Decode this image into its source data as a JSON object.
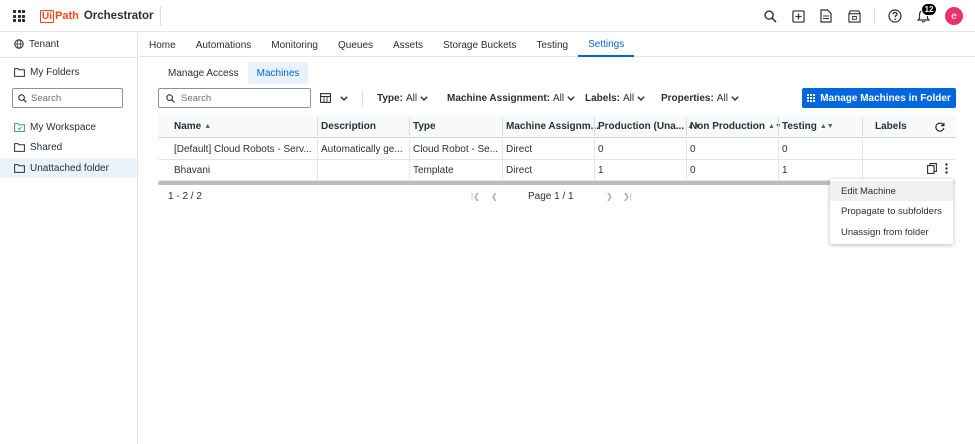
{
  "brand": {
    "logo_ui": "Ui",
    "logo_path": "Path",
    "product": "Orchestrator"
  },
  "topbar": {
    "notification_count": "12",
    "avatar_initial": "e"
  },
  "sidebar": {
    "tenant": "Tenant",
    "my_folders": "My Folders",
    "search_placeholder": "Search",
    "items": [
      {
        "label": "My Workspace",
        "icon": "workspace-icon"
      },
      {
        "label": "Shared",
        "icon": "folder-icon"
      },
      {
        "label": "Unattached folder",
        "icon": "folder-icon",
        "selected": true
      }
    ]
  },
  "main_tabs": [
    "Home",
    "Automations",
    "Monitoring",
    "Queues",
    "Assets",
    "Storage Buckets",
    "Testing",
    "Settings"
  ],
  "main_tabs_active": "Settings",
  "sub_tabs": [
    "Manage Access",
    "Machines"
  ],
  "sub_tabs_active": "Machines",
  "toolbar": {
    "search_placeholder": "Search",
    "filters": [
      {
        "label": "Type:",
        "value": "All"
      },
      {
        "label": "Machine Assignment:",
        "value": "All"
      },
      {
        "label": "Labels:",
        "value": "All"
      },
      {
        "label": "Properties:",
        "value": "All"
      }
    ],
    "primary_button": "Manage Machines in Folder"
  },
  "table": {
    "columns": [
      "Name",
      "Description",
      "Type",
      "Machine Assignm...",
      "Production (Una...",
      "Non Production",
      "Testing",
      "Labels"
    ],
    "rows": [
      {
        "name": "[Default] Cloud Robots - Serv...",
        "description": "Automatically ge...",
        "type": "Cloud Robot - Se...",
        "assignment": "Direct",
        "production": "0",
        "non_production": "0",
        "testing": "0",
        "labels": ""
      },
      {
        "name": "Bhavani",
        "description": "",
        "type": "Template",
        "assignment": "Direct",
        "production": "1",
        "non_production": "0",
        "testing": "1",
        "labels": ""
      }
    ]
  },
  "pager": {
    "count": "1 - 2 / 2",
    "page": "Page 1 / 1"
  },
  "context_menu": {
    "items": [
      "Edit Machine",
      "Propagate to subfolders",
      "Unassign from folder"
    ],
    "hovered": "Edit Machine"
  },
  "colors": {
    "accent": "#0067df",
    "brand": "#fa4616",
    "avatar": "#e8336a"
  }
}
